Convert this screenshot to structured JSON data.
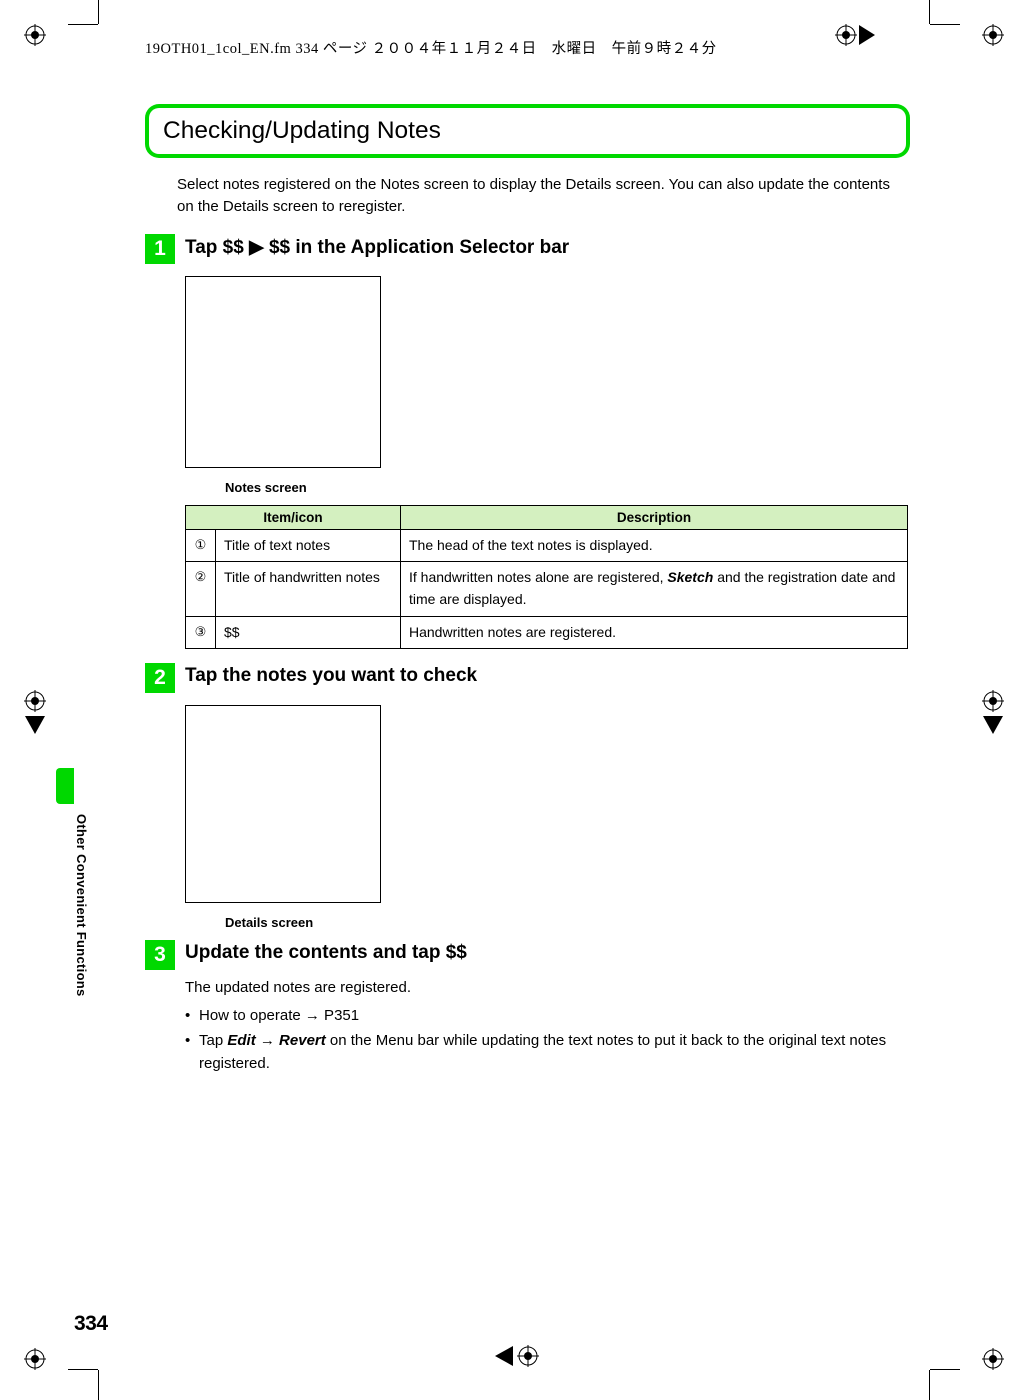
{
  "header_text": "19OTH01_1col_EN.fm  334 ページ  ２００４年１１月２４日　水曜日　午前９時２４分",
  "section_title": "Checking/Updating Notes",
  "intro": "Select notes registered on the Notes screen to display the Details screen. You can also update the contents on the Details screen to reregister.",
  "steps": [
    {
      "num": "1",
      "title_pre": "Tap $$ ",
      "title_post": " $$ in the Application Selector bar",
      "caption": "Notes screen"
    },
    {
      "num": "2",
      "title": "Tap the notes you want to check",
      "caption": "Details screen"
    },
    {
      "num": "3",
      "title": "Update the contents and tap $$",
      "body_line": "The updated notes are registered.",
      "bullet1": "How to operate → P351",
      "bullet2_pre": "Tap ",
      "bullet2_edit": "Edit",
      "bullet2_arrow": " → ",
      "bullet2_revert": "Revert",
      "bullet2_post": " on the Menu bar while updating the text notes to put it back to the original text notes registered."
    }
  ],
  "table": {
    "headers": [
      "Item/icon",
      "Description"
    ],
    "rows": [
      {
        "num": "①",
        "item": "Title of text notes",
        "desc": "The head of the text notes is displayed."
      },
      {
        "num": "②",
        "item": "Title of handwritten notes",
        "desc_pre": "If handwritten notes alone are registered, ",
        "desc_sketch": "Sketch",
        "desc_post": " and the registration date and time are displayed."
      },
      {
        "num": "③",
        "item": "$$",
        "desc": "Handwritten notes are registered."
      }
    ]
  },
  "side_label": "Other Convenient Functions",
  "page_num": "334"
}
